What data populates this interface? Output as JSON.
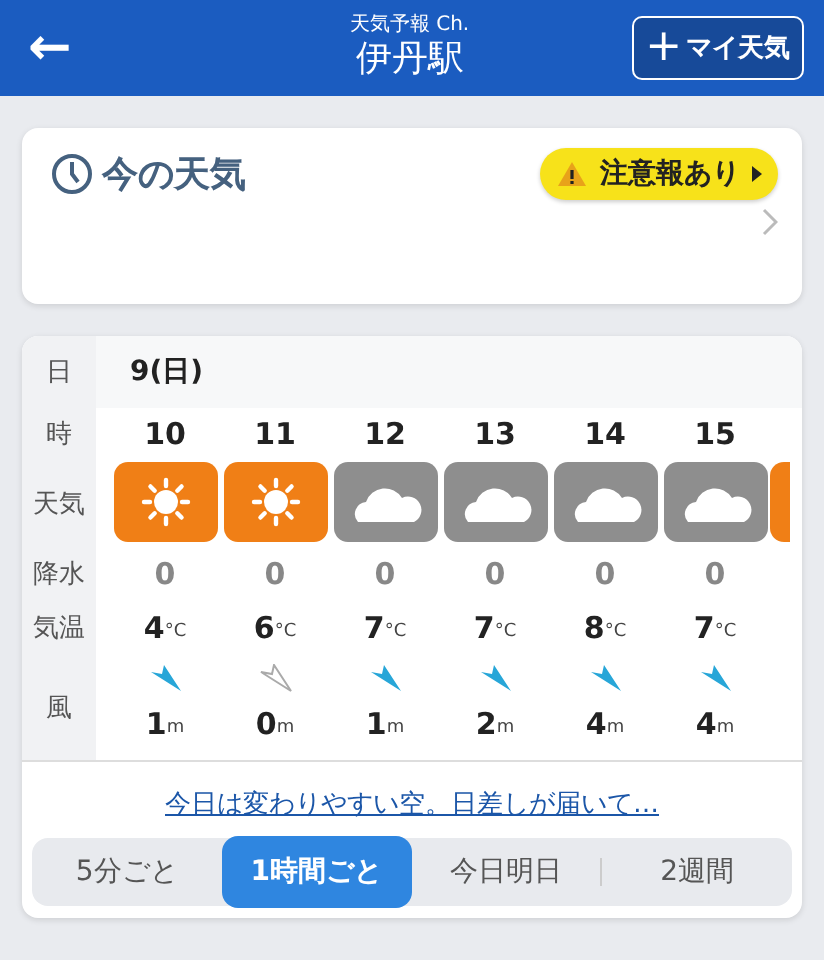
{
  "header": {
    "back_icon": "←",
    "subtitle": "天気予報 Ch.",
    "title": "伊丹駅",
    "my_weather_button": {
      "plus": "+",
      "label": "マイ天気"
    }
  },
  "current": {
    "title": "今の天気",
    "warning_badge": "注意報あり"
  },
  "forecast": {
    "row_labels": {
      "day": "日",
      "hour": "時",
      "weather": "天気",
      "rain": "降水",
      "temp": "気温",
      "wind": "風"
    },
    "day": "9(日)",
    "hours": [
      {
        "hour": "10",
        "kind": "sunny",
        "rain": "0",
        "temp": "4",
        "temp_unit": "°C",
        "calm": false,
        "wind": "1",
        "wind_unit": "m"
      },
      {
        "hour": "11",
        "kind": "sunny",
        "rain": "0",
        "temp": "6",
        "temp_unit": "°C",
        "calm": true,
        "wind": "0",
        "wind_unit": "m"
      },
      {
        "hour": "12",
        "kind": "cloudy",
        "rain": "0",
        "temp": "7",
        "temp_unit": "°C",
        "calm": false,
        "wind": "1",
        "wind_unit": "m"
      },
      {
        "hour": "13",
        "kind": "cloudy",
        "rain": "0",
        "temp": "7",
        "temp_unit": "°C",
        "calm": false,
        "wind": "2",
        "wind_unit": "m"
      },
      {
        "hour": "14",
        "kind": "cloudy",
        "rain": "0",
        "temp": "8",
        "temp_unit": "°C",
        "calm": false,
        "wind": "4",
        "wind_unit": "m"
      },
      {
        "hour": "15",
        "kind": "cloudy",
        "rain": "0",
        "temp": "7",
        "temp_unit": "°C",
        "calm": false,
        "wind": "4",
        "wind_unit": "m"
      }
    ],
    "next": {
      "kind": "sunny"
    }
  },
  "summary_link": "今日は変わりやすい空。日差しが届いて…",
  "tabs": [
    {
      "label": "5分ごと",
      "selected": false
    },
    {
      "label": "1時間ごと",
      "selected": true
    },
    {
      "label": "今日明日",
      "selected": false
    },
    {
      "label": "2週間",
      "selected": false
    }
  ]
}
